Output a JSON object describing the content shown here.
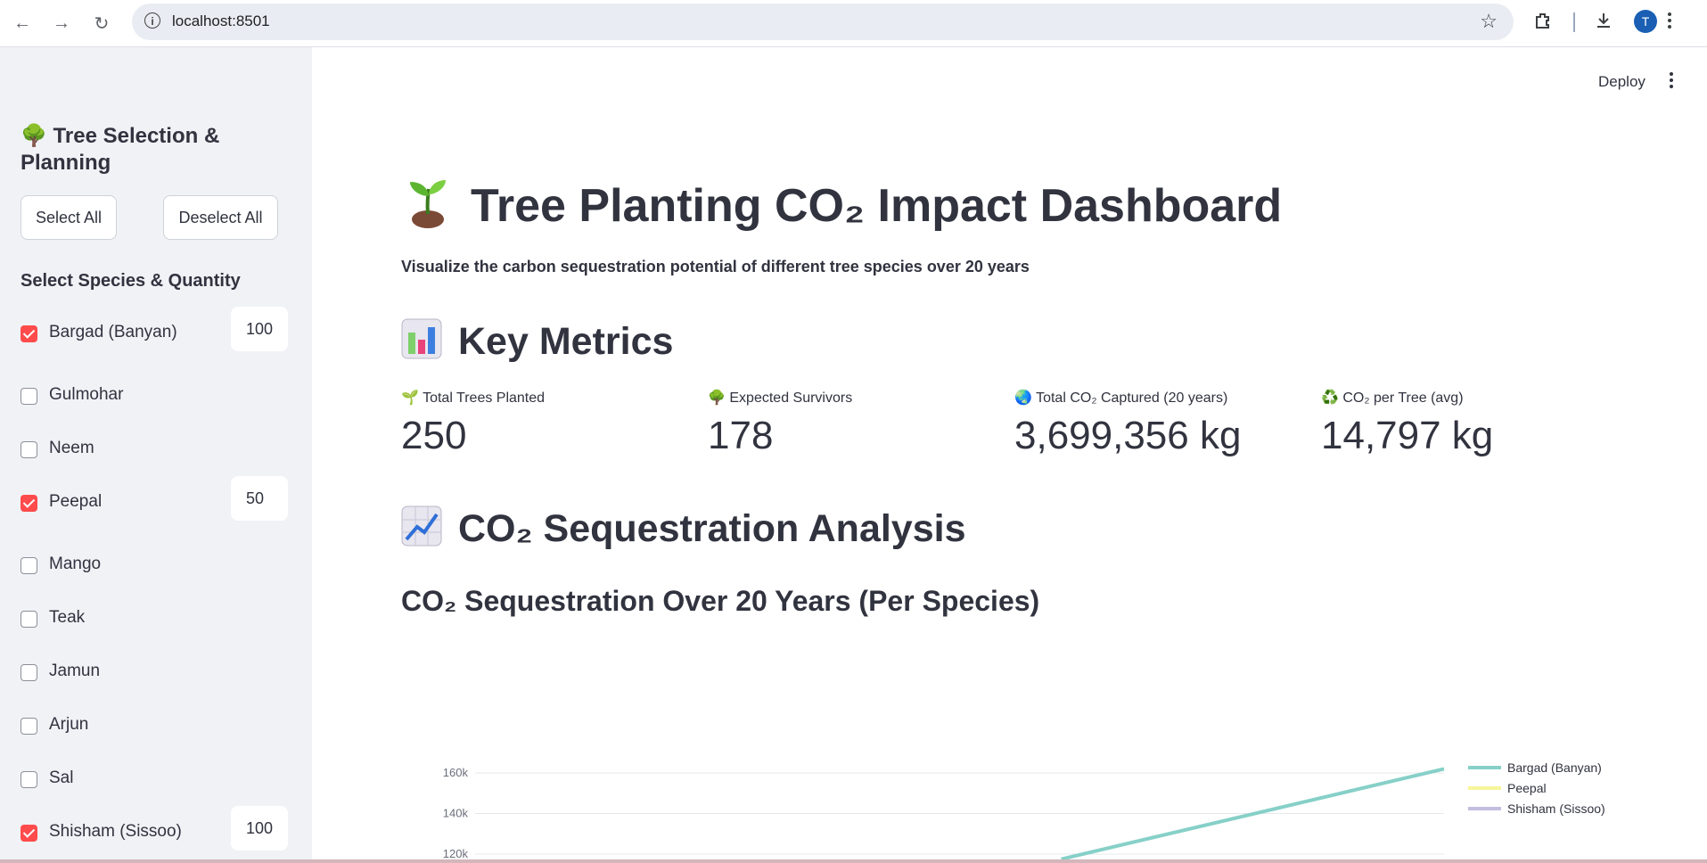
{
  "browser": {
    "url": "localhost:8501",
    "profile_initial": "T"
  },
  "sidebar": {
    "title": "🌳 Tree Selection & Planning",
    "select_all_label": "Select All",
    "deselect_all_label": "Deselect All",
    "species_heading": "Select Species & Quantity",
    "species": [
      {
        "label": "Bargad (Banyan)",
        "checked": true,
        "quantity": "100"
      },
      {
        "label": "Gulmohar",
        "checked": false
      },
      {
        "label": "Neem",
        "checked": false
      },
      {
        "label": "Peepal",
        "checked": true,
        "quantity": "50"
      },
      {
        "label": "Mango",
        "checked": false
      },
      {
        "label": "Teak",
        "checked": false
      },
      {
        "label": "Jamun",
        "checked": false
      },
      {
        "label": "Arjun",
        "checked": false
      },
      {
        "label": "Sal",
        "checked": false
      },
      {
        "label": "Shisham (Sissoo)",
        "checked": true,
        "quantity": "100"
      }
    ]
  },
  "header": {
    "deploy_label": "Deploy"
  },
  "main": {
    "title": "Tree Planting CO₂ Impact Dashboard",
    "subtitle": "Visualize the carbon sequestration potential of different tree species over 20 years",
    "metrics_heading": "Key Metrics",
    "metrics": [
      {
        "icon": "🌱",
        "label": "Total Trees Planted",
        "value": "250"
      },
      {
        "icon": "🌳",
        "label": "Expected Survivors",
        "value": "178"
      },
      {
        "icon": "🌏",
        "label": "Total CO₂ Captured (20 years)",
        "value": "3,699,356 kg"
      },
      {
        "icon": "♻️",
        "label": "CO₂ per Tree (avg)",
        "value": "14,797 kg"
      }
    ],
    "analysis_heading": "CO₂ Sequestration Analysis",
    "chart_heading": "CO₂ Sequestration Over 20 Years (Per Species)"
  },
  "colors": {
    "accent": "#ff4b4b",
    "sidebar_bg": "#f0f2f6",
    "text": "#31333f"
  },
  "chart_data": {
    "type": "line",
    "title": "CO₂ Sequestration Over 20 Years (Per Species)",
    "xlim": [
      0,
      20
    ],
    "ylim": [
      120000,
      160000
    ],
    "yticks": [
      {
        "value": 160000,
        "label": "160k"
      },
      {
        "value": 140000,
        "label": "140k"
      },
      {
        "value": 120000,
        "label": "120k"
      }
    ],
    "grid": true,
    "legend_position": "top-right",
    "series": [
      {
        "name": "Bargad (Banyan)",
        "color": "#86d0c8",
        "x": [
          12.1,
          20
        ],
        "y": [
          117500,
          162000
        ]
      },
      {
        "name": "Peepal",
        "color": "#f7f59a",
        "x": [],
        "y": []
      },
      {
        "name": "Shisham (Sissoo)",
        "color": "#c3bde0",
        "x": [],
        "y": []
      }
    ]
  }
}
